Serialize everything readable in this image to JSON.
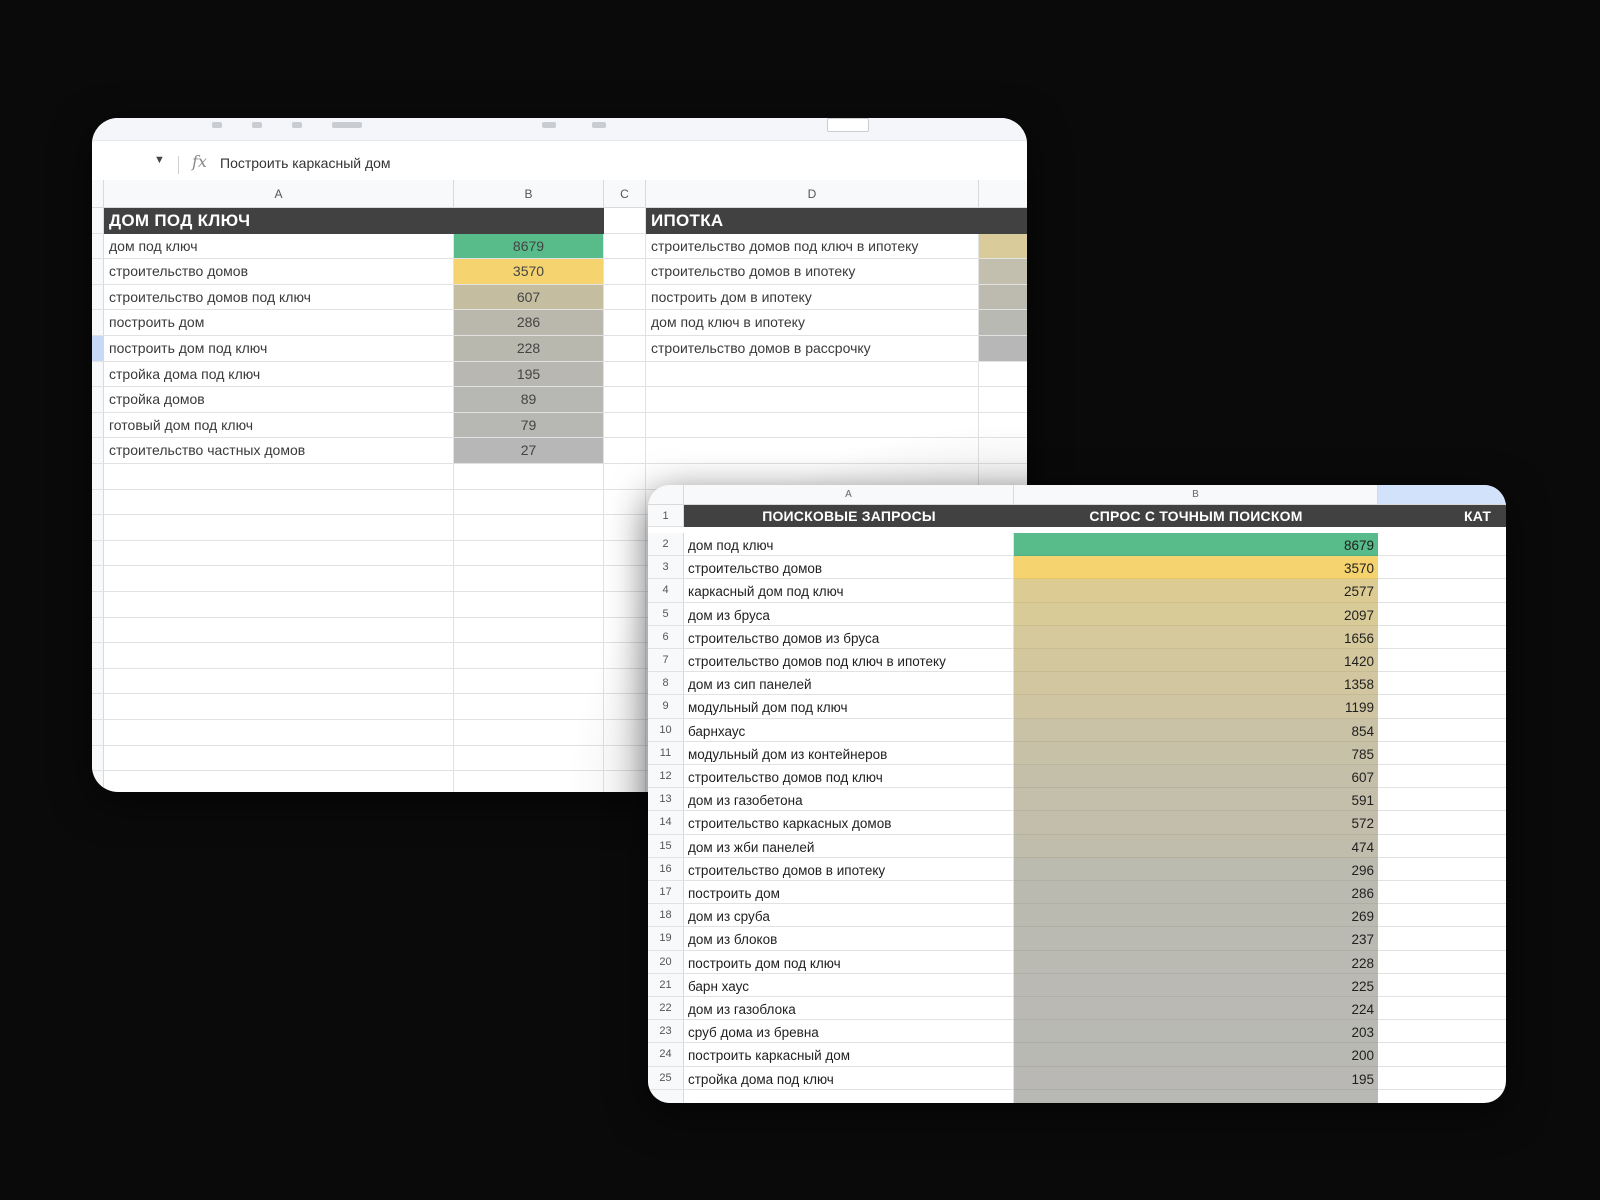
{
  "colors": {
    "background": "#0a0a0a",
    "header_dark": "#414141",
    "green": "#57bb8a",
    "yellow": "#f5d36f",
    "tan": "#d9cfa4",
    "gray": "#b7b7b7",
    "selection": "#d3e2fb"
  },
  "sheet1": {
    "formula_bar": {
      "fx_icon": "fx",
      "content": "Построить каркасный дом"
    },
    "columns": [
      "A",
      "B",
      "C",
      "D"
    ],
    "left_section": {
      "title": "ДОМ ПОД КЛЮЧ",
      "rows": [
        {
          "query": "дом под ключ",
          "value": "8679",
          "color": "#57bb8a"
        },
        {
          "query": "строительство домов",
          "value": "3570",
          "color": "#f5d36f"
        },
        {
          "query": "строительство домов под ключ",
          "value": "607",
          "color": "#c4bd9f"
        },
        {
          "query": "построить дом",
          "value": "286",
          "color": "#bab8ad"
        },
        {
          "query": "построить дом под ключ",
          "value": "228",
          "color": "#b9b8af"
        },
        {
          "query": "стройка дома под ключ",
          "value": "195",
          "color": "#b8b7b1"
        },
        {
          "query": "стройка домов",
          "value": "89",
          "color": "#b7b7b3"
        },
        {
          "query": "готовый дом под ключ",
          "value": "79",
          "color": "#b7b7b4"
        },
        {
          "query": "строительство частных домов",
          "value": "27",
          "color": "#b7b7b7"
        }
      ]
    },
    "right_section": {
      "title": "ИПОТКА",
      "rows": [
        {
          "query": "строительство домов под ключ в ипотеку",
          "color": "#d9cb9a"
        },
        {
          "query": "строительство домов в ипотеку",
          "color": "#c2bfae"
        },
        {
          "query": "построить дом в ипотеку",
          "color": "#bdbbb0"
        },
        {
          "query": "дом под ключ в ипотеку",
          "color": "#b9b9b3"
        },
        {
          "query": "строительство домов в рассрочку",
          "color": "#b7b7b7"
        }
      ]
    }
  },
  "sheet2": {
    "columns": [
      "A",
      "B"
    ],
    "header_row": {
      "num": "1",
      "col_a": "ПОИСКОВЫЕ ЗАПРОСЫ",
      "col_b": "СПРОС С ТОЧНЫМ ПОИСКОМ",
      "col_c": "КАТ"
    },
    "rows": [
      {
        "num": "2",
        "query": "дом под ключ",
        "value": "8679",
        "color": "#57bb8a"
      },
      {
        "num": "3",
        "query": "строительство домов",
        "value": "3570",
        "color": "#f5d36f"
      },
      {
        "num": "4",
        "query": "каркасный дом под ключ",
        "value": "2577",
        "color": "#dccc93"
      },
      {
        "num": "5",
        "query": "дом из бруса",
        "value": "2097",
        "color": "#d9cb97"
      },
      {
        "num": "6",
        "query": "строительство домов из бруса",
        "value": "1656",
        "color": "#d6c99b"
      },
      {
        "num": "7",
        "query": "строительство домов под ключ в ипотеку",
        "value": "1420",
        "color": "#d3c79e"
      },
      {
        "num": "8",
        "query": "дом из сип панелей",
        "value": "1358",
        "color": "#d1c6a0"
      },
      {
        "num": "9",
        "query": "модульный дом под ключ",
        "value": "1199",
        "color": "#cfc5a2"
      },
      {
        "num": "10",
        "query": "барнхаус",
        "value": "854",
        "color": "#c9c2a6"
      },
      {
        "num": "11",
        "query": "модульный дом из контейнеров",
        "value": "785",
        "color": "#c7c1a7"
      },
      {
        "num": "12",
        "query": "строительство домов под ключ",
        "value": "607",
        "color": "#c4bfa9"
      },
      {
        "num": "13",
        "query": "дом из газобетона",
        "value": "591",
        "color": "#c3bfaa"
      },
      {
        "num": "14",
        "query": "строительство каркасных домов",
        "value": "572",
        "color": "#c2beab"
      },
      {
        "num": "15",
        "query": "дом из жби панелей",
        "value": "474",
        "color": "#c0bdad"
      },
      {
        "num": "16",
        "query": "строительство домов в ипотеку",
        "value": "296",
        "color": "#bcbbb0"
      },
      {
        "num": "17",
        "query": "построить дом",
        "value": "286",
        "color": "#bbbab1"
      },
      {
        "num": "18",
        "query": "дом из сруба",
        "value": "269",
        "color": "#bbbab1"
      },
      {
        "num": "19",
        "query": "дом из блоков",
        "value": "237",
        "color": "#bab9b2"
      },
      {
        "num": "20",
        "query": "построить дом под ключ",
        "value": "228",
        "color": "#bab9b2"
      },
      {
        "num": "21",
        "query": "барн хаус",
        "value": "225",
        "color": "#bab9b3"
      },
      {
        "num": "22",
        "query": "дом из газоблока",
        "value": "224",
        "color": "#bab9b3"
      },
      {
        "num": "23",
        "query": "сруб дома из бревна",
        "value": "203",
        "color": "#b9b9b4"
      },
      {
        "num": "24",
        "query": "построить каркасный дом",
        "value": "200",
        "color": "#b9b9b4"
      },
      {
        "num": "25",
        "query": "стройка дома под ключ",
        "value": "195",
        "color": "#b9b8b4"
      }
    ]
  }
}
